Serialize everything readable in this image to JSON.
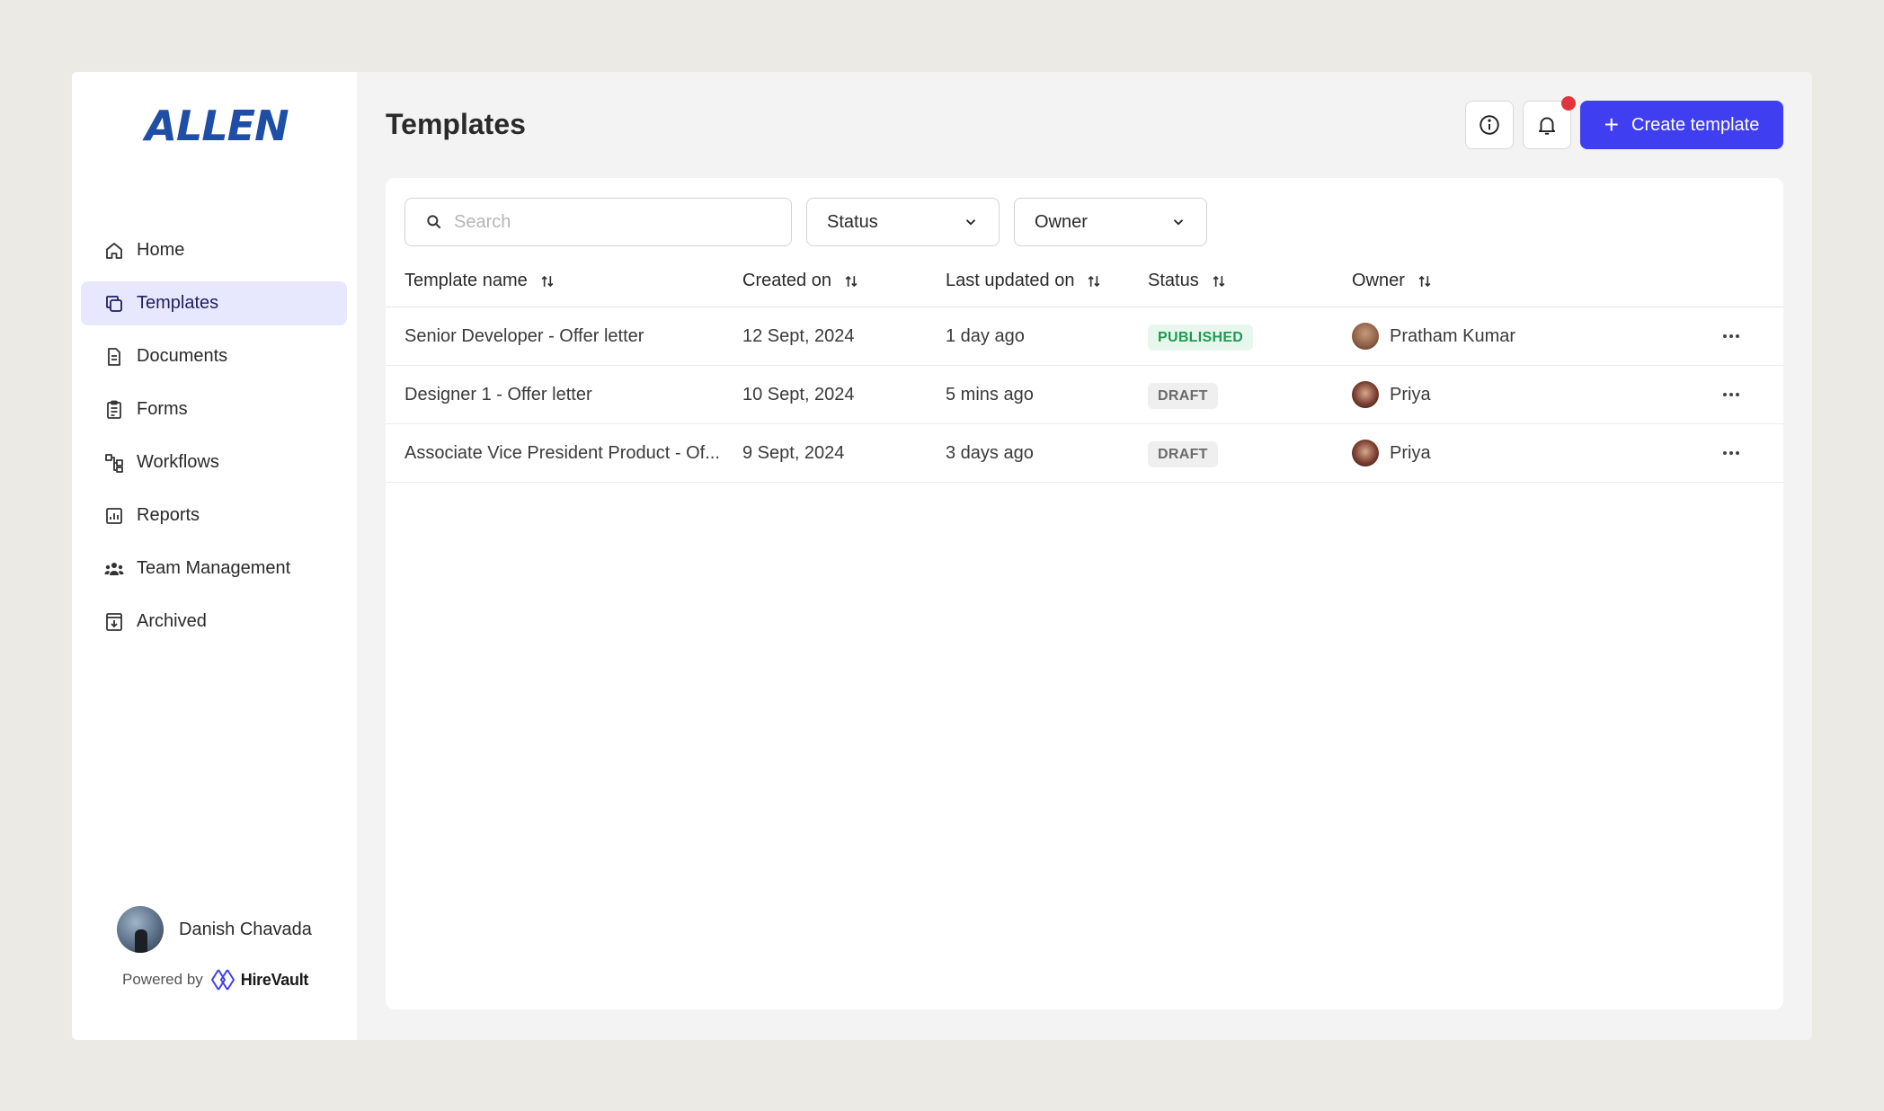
{
  "brand": {
    "logo_text": "ALLEN"
  },
  "sidebar": {
    "items": [
      {
        "label": "Home",
        "icon": "home-icon",
        "active": false
      },
      {
        "label": "Templates",
        "icon": "templates-icon",
        "active": true
      },
      {
        "label": "Documents",
        "icon": "document-icon",
        "active": false
      },
      {
        "label": "Forms",
        "icon": "clipboard-icon",
        "active": false
      },
      {
        "label": "Workflows",
        "icon": "workflow-icon",
        "active": false
      },
      {
        "label": "Reports",
        "icon": "chart-icon",
        "active": false
      },
      {
        "label": "Team Management",
        "icon": "team-icon",
        "active": false
      },
      {
        "label": "Archived",
        "icon": "archive-icon",
        "active": false
      }
    ],
    "user": {
      "name": "Danish Chavada"
    },
    "powered_by": {
      "prefix": "Powered by",
      "product": "HireVault"
    }
  },
  "header": {
    "title": "Templates",
    "create_label": "Create template"
  },
  "filters": {
    "search_placeholder": "Search",
    "status_label": "Status",
    "owner_label": "Owner"
  },
  "table": {
    "columns": [
      "Template name",
      "Created on",
      "Last updated on",
      "Status",
      "Owner"
    ],
    "rows": [
      {
        "name": "Senior Developer - Offer letter",
        "created": "12 Sept, 2024",
        "updated": "1 day ago",
        "status": "PUBLISHED",
        "owner": "Pratham Kumar"
      },
      {
        "name": "Designer 1 - Offer letter",
        "created": "10 Sept, 2024",
        "updated": "5 mins ago",
        "status": "DRAFT",
        "owner": "Priya"
      },
      {
        "name": "Associate Vice President Product - Of...",
        "created": "9 Sept, 2024",
        "updated": "3 days ago",
        "status": "DRAFT",
        "owner": "Priya"
      }
    ]
  },
  "colors": {
    "accent": "#3f3ef0",
    "brand": "#1f4ea6",
    "published": "#1f9a52",
    "notification": "#e0363b"
  }
}
